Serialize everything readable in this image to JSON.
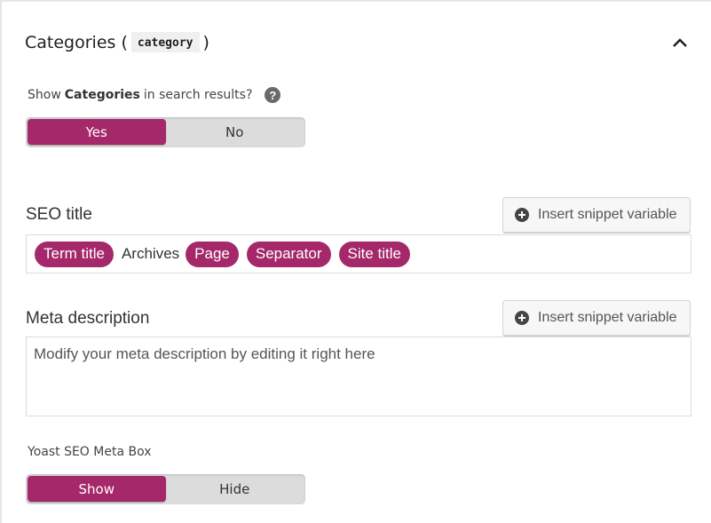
{
  "section": {
    "title_prefix": "Categories (",
    "title_code": "category",
    "title_suffix": ")",
    "collapse_icon": "chevron-up-icon"
  },
  "search_visibility": {
    "label_prefix": "Show",
    "label_bold": "Categories",
    "label_suffix": "in search results?",
    "help_icon": "?",
    "options": [
      {
        "label": "Yes",
        "active": true
      },
      {
        "label": "No",
        "active": false
      }
    ]
  },
  "seo_title": {
    "label": "SEO title",
    "snippet_button": "Insert snippet variable",
    "tokens": [
      {
        "type": "variable",
        "text": "Term title"
      },
      {
        "type": "text",
        "text": "Archives"
      },
      {
        "type": "variable",
        "text": "Page"
      },
      {
        "type": "variable",
        "text": "Separator"
      },
      {
        "type": "variable",
        "text": "Site title"
      }
    ]
  },
  "meta_description": {
    "label": "Meta description",
    "snippet_button": "Insert snippet variable",
    "placeholder": "Modify your meta description by editing it right here"
  },
  "meta_box": {
    "label": "Yoast SEO Meta Box",
    "options": [
      {
        "label": "Show",
        "active": true
      },
      {
        "label": "Hide",
        "active": false
      }
    ]
  },
  "colors": {
    "accent": "#a4286a",
    "toggle_bg": "#dcdcdc"
  }
}
